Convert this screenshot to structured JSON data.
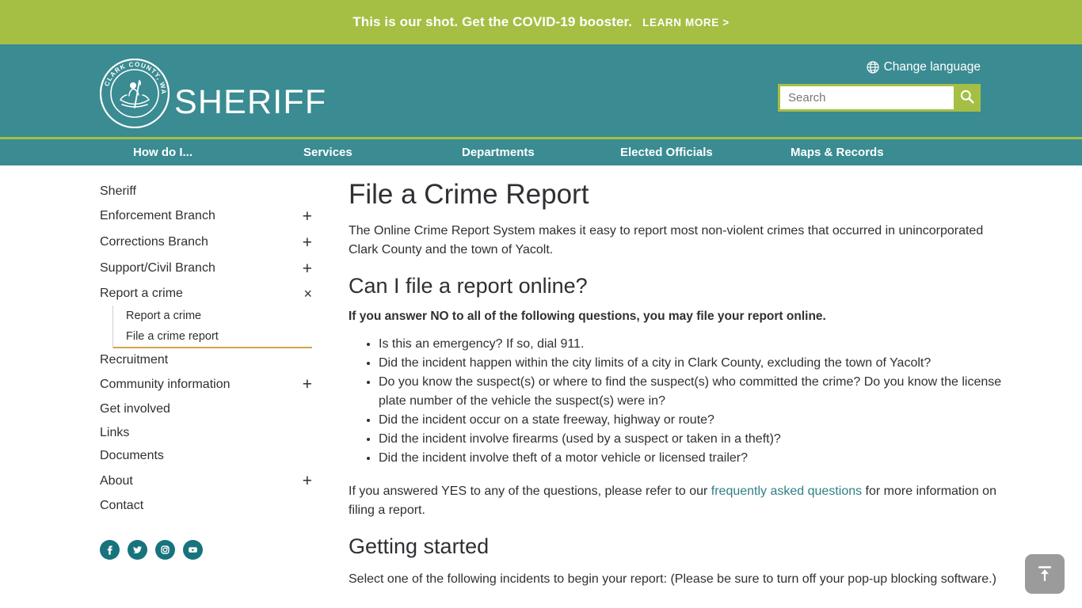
{
  "alert": {
    "message": "This is our shot. Get the COVID-19 booster.",
    "link_label": "LEARN MORE >"
  },
  "header": {
    "site_title": "SHERIFF",
    "seal_text": "CLARK COUNTY, WASHINGTON",
    "change_language": "Change language",
    "search_placeholder": "Search",
    "search_value": ""
  },
  "main_nav": {
    "items": [
      {
        "label": "How do I..."
      },
      {
        "label": "Services"
      },
      {
        "label": "Departments"
      },
      {
        "label": "Elected Officials"
      },
      {
        "label": "Maps & Records"
      }
    ]
  },
  "sidebar": {
    "items": [
      {
        "label": "Sheriff",
        "toggle": ""
      },
      {
        "label": "Enforcement Branch",
        "toggle": "+"
      },
      {
        "label": "Corrections Branch",
        "toggle": "+"
      },
      {
        "label": "Support/Civil Branch",
        "toggle": "+"
      },
      {
        "label": "Report a crime",
        "toggle": "×"
      },
      {
        "label": "Recruitment",
        "toggle": ""
      },
      {
        "label": "Community information",
        "toggle": "+"
      },
      {
        "label": "Get involved",
        "toggle": ""
      },
      {
        "label": "Links",
        "toggle": ""
      },
      {
        "label": "Documents",
        "toggle": ""
      },
      {
        "label": "About",
        "toggle": "+"
      },
      {
        "label": "Contact",
        "toggle": ""
      }
    ],
    "sub_items": [
      {
        "label": "Report a crime",
        "active": false
      },
      {
        "label": "File a crime report",
        "active": true
      }
    ],
    "socials": [
      {
        "name": "facebook"
      },
      {
        "name": "twitter"
      },
      {
        "name": "instagram"
      },
      {
        "name": "youtube"
      }
    ]
  },
  "content": {
    "title": "File a Crime Report",
    "intro": "The Online Crime Report System makes it easy to report most non-violent crimes that occurred in unincorporated Clark County and the town of Yacolt.",
    "section1_title": "Can I file a report online?",
    "section1_lead": "If you answer NO to all of the following questions, you may file your report online.",
    "questions": [
      "Is this an emergency? If so, dial 911.",
      "Did the incident happen within the city limits of a city in Clark County, excluding the town of Yacolt?",
      "Do you know the suspect(s) or where to find the suspect(s) who committed the crime? Do you know the license plate number of the vehicle the suspect(s) were in?",
      "Did the incident occur on a state freeway, highway or route?",
      "Did the incident involve firearms (used by a suspect or taken in a theft)?",
      "Did the incident involve theft of a motor vehicle or licensed trailer?"
    ],
    "yes_text_before": "If you answered YES to any of the questions, please refer to our ",
    "yes_link": "frequently asked questions",
    "yes_text_after": " for more information on filing a report.",
    "section2_title": "Getting started",
    "section2_text": "Select one of the following incidents to begin your report: (Please be sure to turn off your pop-up blocking software.)"
  },
  "back_to_top": {
    "label": "Back to top"
  },
  "colors": {
    "banner_green": "#a4bf43",
    "header_teal": "#3a8b92",
    "link_teal": "#2f7f86",
    "active_underline": "#d2a54a",
    "social_teal": "#17737c"
  }
}
